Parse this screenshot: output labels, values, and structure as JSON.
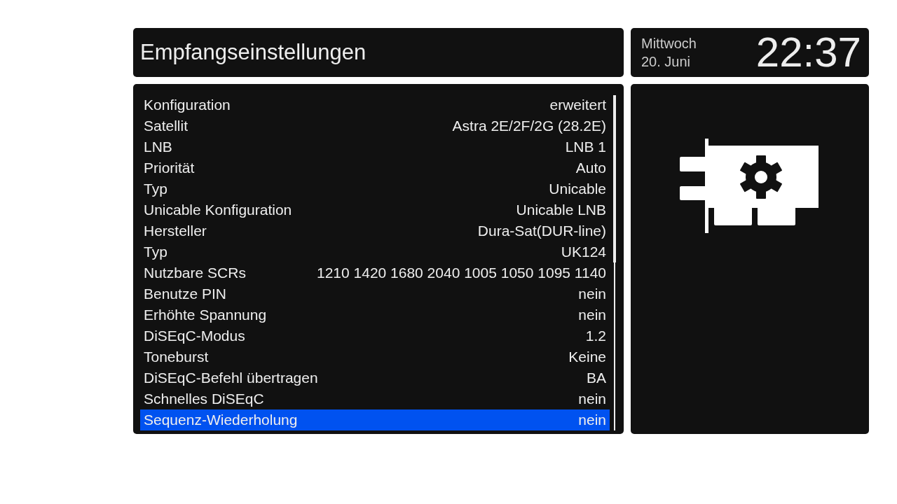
{
  "header": {
    "title": "Empfangseinstellungen"
  },
  "clock": {
    "weekday": "Mittwoch",
    "date": "20. Juni",
    "time": "22:37"
  },
  "settings": [
    {
      "label": "Konfiguration",
      "value": "erweitert",
      "selected": false
    },
    {
      "label": "Satellit",
      "value": "Astra 2E/2F/2G (28.2E)",
      "selected": false
    },
    {
      "label": "LNB",
      "value": "LNB 1",
      "selected": false
    },
    {
      "label": "Priorität",
      "value": "Auto",
      "selected": false
    },
    {
      "label": "Typ",
      "value": "Unicable",
      "selected": false
    },
    {
      "label": "Unicable Konfiguration",
      "value": "Unicable LNB",
      "selected": false
    },
    {
      "label": "Hersteller",
      "value": "Dura-Sat(DUR-line)",
      "selected": false
    },
    {
      "label": "Typ",
      "value": "UK124",
      "selected": false
    },
    {
      "label": "Nutzbare SCRs",
      "value": "1210 1420 1680 2040 1005 1050 1095 1140",
      "selected": false
    },
    {
      "label": "Benutze PIN",
      "value": "nein",
      "selected": false
    },
    {
      "label": "Erhöhte Spannung",
      "value": "nein",
      "selected": false
    },
    {
      "label": "DiSEqC-Modus",
      "value": "1.2",
      "selected": false
    },
    {
      "label": "Toneburst",
      "value": "Keine",
      "selected": false
    },
    {
      "label": "DiSEqC-Befehl übertragen",
      "value": "BA",
      "selected": false
    },
    {
      "label": "Schnelles DiSEqC",
      "value": "nein",
      "selected": false
    },
    {
      "label": "Sequenz-Wiederholung",
      "value": "nein",
      "selected": true
    }
  ]
}
